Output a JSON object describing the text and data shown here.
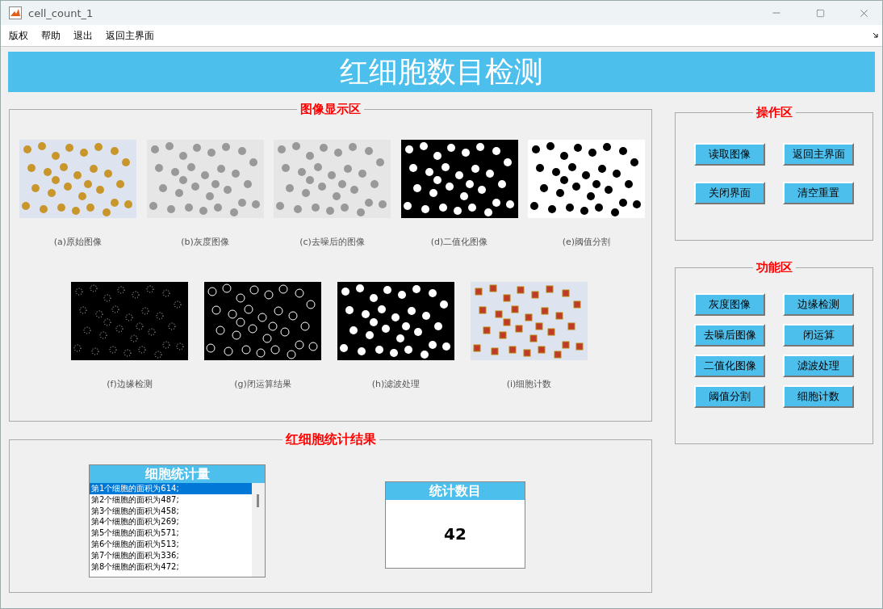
{
  "window": {
    "title": "cell_count_1"
  },
  "menu": [
    "版权",
    "帮助",
    "退出",
    "返回主界面"
  ],
  "banner": "红细胞数目检测",
  "image_panel": {
    "title": "图像显示区",
    "rows": [
      [
        {
          "caption": "(a)原始图像",
          "kind": "color"
        },
        {
          "caption": "(b)灰度图像",
          "kind": "gray"
        },
        {
          "caption": "(c)去噪后的图像",
          "kind": "gray"
        },
        {
          "caption": "(d)二值化图像",
          "kind": "dark"
        },
        {
          "caption": "(e)阈值分割",
          "kind": "light"
        }
      ],
      [
        {
          "caption": "(f)边缘检测",
          "kind": "edges"
        },
        {
          "caption": "(g)闭运算结果",
          "kind": "rings"
        },
        {
          "caption": "(h)滤波处理",
          "kind": "dark"
        },
        {
          "caption": "(i)细胞计数",
          "kind": "marked"
        }
      ]
    ]
  },
  "operation_panel": {
    "title": "操作区",
    "buttons": [
      "读取图像",
      "返回主界面",
      "关闭界面",
      "清空重置"
    ]
  },
  "function_panel": {
    "title": "功能区",
    "buttons": [
      "灰度图像",
      "边缘检测",
      "去噪后图像",
      "闭运算",
      "二值化图像",
      "滤波处理",
      "阈值分割",
      "细胞计数"
    ]
  },
  "results_panel": {
    "title": "红细胞统计结果",
    "list": {
      "title": "细胞统计量",
      "items": [
        {
          "text": "第1个细胞的面积为614;",
          "selected": true
        },
        {
          "text": "第2个细胞的面积为487;",
          "selected": false
        },
        {
          "text": "第3个细胞的面积为458;",
          "selected": false
        },
        {
          "text": "第4个细胞的面积为269;",
          "selected": false
        },
        {
          "text": "第5个细胞的面积为571;",
          "selected": false
        },
        {
          "text": "第6个细胞的面积为513;",
          "selected": false
        },
        {
          "text": "第7个细胞的面积为336;",
          "selected": false
        },
        {
          "text": "第8个细胞的面积为472;",
          "selected": false
        }
      ]
    },
    "count": {
      "title": "统计数目",
      "value": "42"
    }
  }
}
